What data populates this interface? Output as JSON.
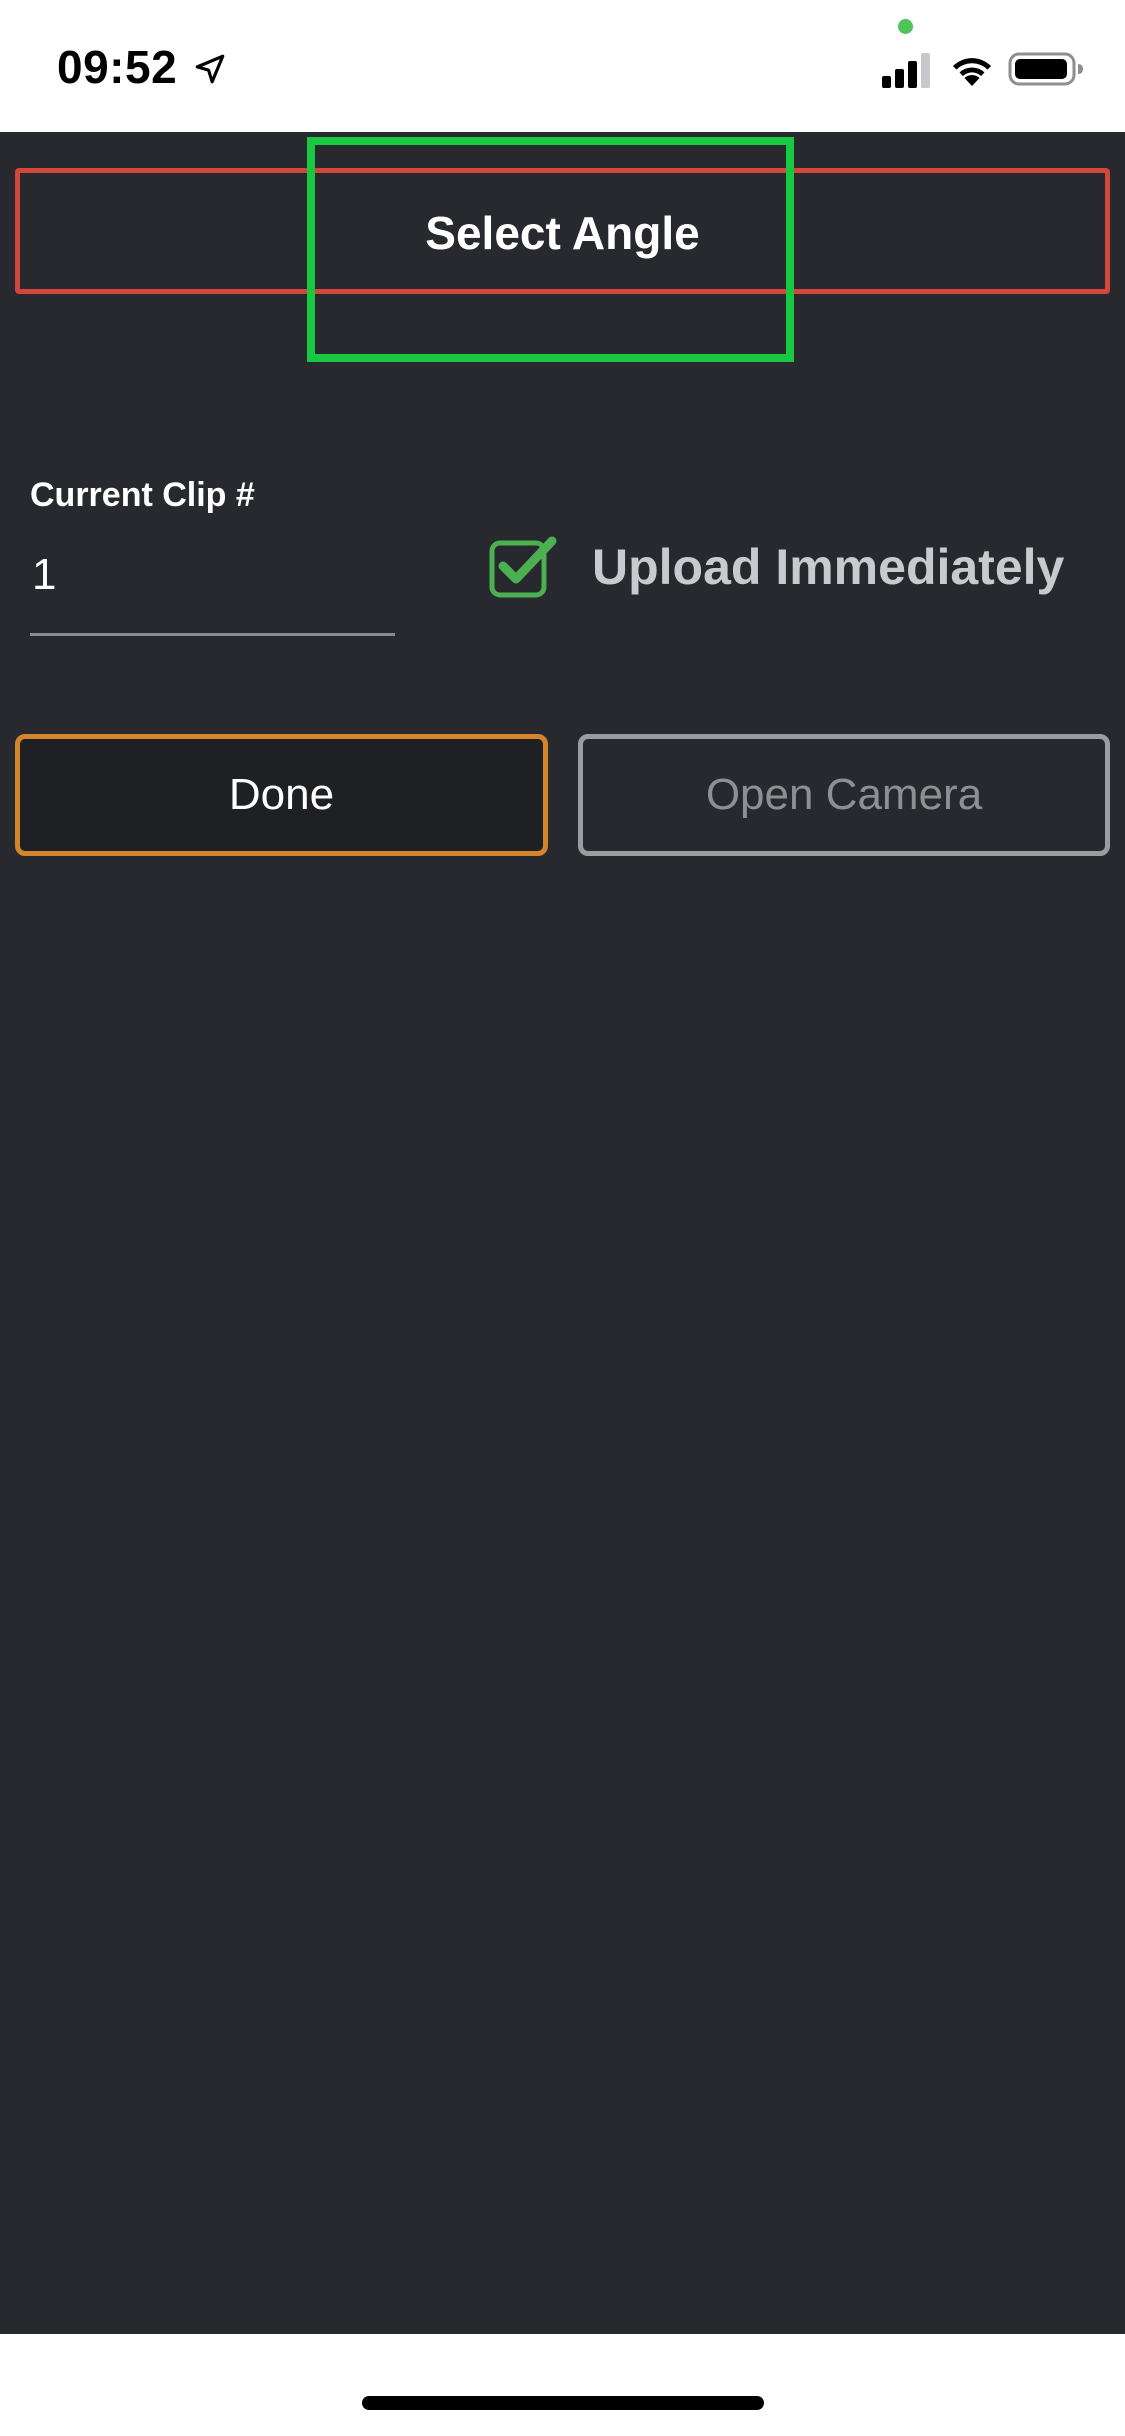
{
  "status_bar": {
    "time": "09:52",
    "location_icon": "location-arrow-icon",
    "signal_icon": "cellular-signal-icon",
    "wifi_icon": "wifi-icon",
    "battery_icon": "battery-icon",
    "indicator_color": "#4fc45a"
  },
  "header": {
    "title": "Select Angle",
    "border_color": "#d3463b",
    "highlight_color": "#18c742"
  },
  "clip": {
    "label": "Current Clip #",
    "value": "1"
  },
  "upload": {
    "label": "Upload Immediately",
    "checked": true,
    "check_color": "#4caf50"
  },
  "buttons": {
    "done_label": "Done",
    "open_camera_label": "Open Camera",
    "done_border_color": "#d4852c",
    "camera_border_color": "#9a9ca0"
  },
  "colors": {
    "background": "#27292e"
  }
}
